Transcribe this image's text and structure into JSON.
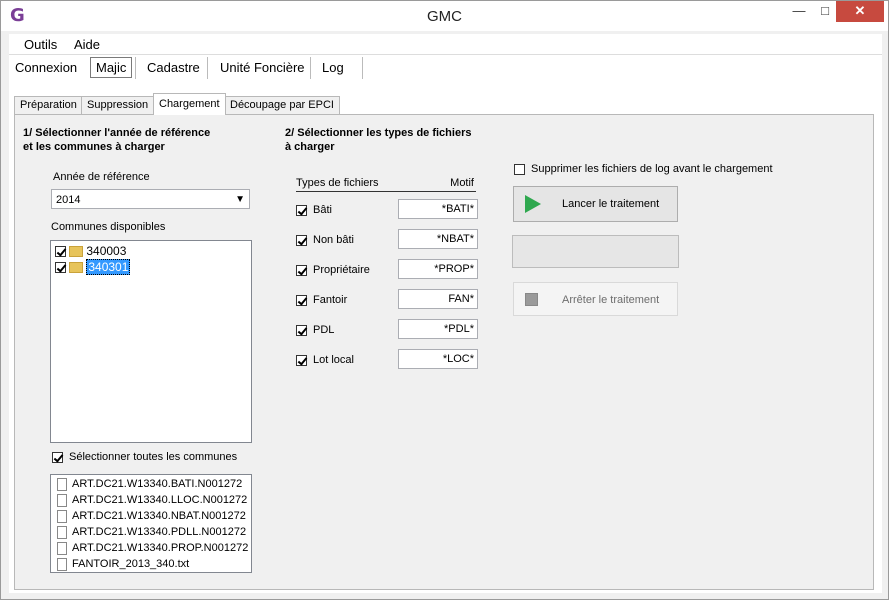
{
  "window": {
    "title": "GMC"
  },
  "menu": {
    "items": [
      "Outils",
      "Aide"
    ]
  },
  "main_tabs": [
    "Connexion",
    "Majic",
    "Cadastre",
    "Unité Foncière",
    "Log"
  ],
  "sub_tabs": [
    "Préparation",
    "Suppression",
    "Chargement",
    "Découpage par EPCI"
  ],
  "section1": {
    "title_line1": "1/ Sélectionner l'année de référence",
    "title_line2": "et les communes à charger",
    "year_label": "Année de référence",
    "year_value": "2014",
    "communes_label": "Communes disponibles",
    "communes": [
      {
        "code": "340003",
        "checked": true
      },
      {
        "code": "340301",
        "checked": true,
        "selected": true
      }
    ],
    "select_all_label": "Sélectionner toutes les communes",
    "files": [
      "ART.DC21.W13340.BATI.N001272",
      "ART.DC21.W13340.LLOC.N001272",
      "ART.DC21.W13340.NBAT.N001272",
      "ART.DC21.W13340.PDLL.N001272",
      "ART.DC21.W13340.PROP.N001272",
      "FANTOIR_2013_340.txt"
    ]
  },
  "section2": {
    "title_line1": "2/ Sélectionner les types de fichiers",
    "title_line2": "à charger",
    "col_types": "Types de fichiers",
    "col_motif": "Motif",
    "types": [
      {
        "label": "Bâti",
        "motif": "*BATI*",
        "checked": true
      },
      {
        "label": "Non bâti",
        "motif": "*NBAT*",
        "checked": true
      },
      {
        "label": "Propriétaire",
        "motif": "*PROP*",
        "checked": true
      },
      {
        "label": "Fantoir",
        "motif": "FAN*",
        "checked": true
      },
      {
        "label": "PDL",
        "motif": "*PDL*",
        "checked": true
      },
      {
        "label": "Lot local",
        "motif": "*LOC*",
        "checked": true
      }
    ]
  },
  "actions": {
    "delete_logs_label": "Supprimer les fichiers de log avant le chargement",
    "delete_logs_checked": false,
    "start_label": "Lancer le traitement",
    "stop_label": "Arrêter le traitement",
    "progress": 0
  },
  "icons": {
    "start": "play-icon",
    "stop": "stop-icon",
    "folder": "folder-icon",
    "file": "file-icon"
  }
}
